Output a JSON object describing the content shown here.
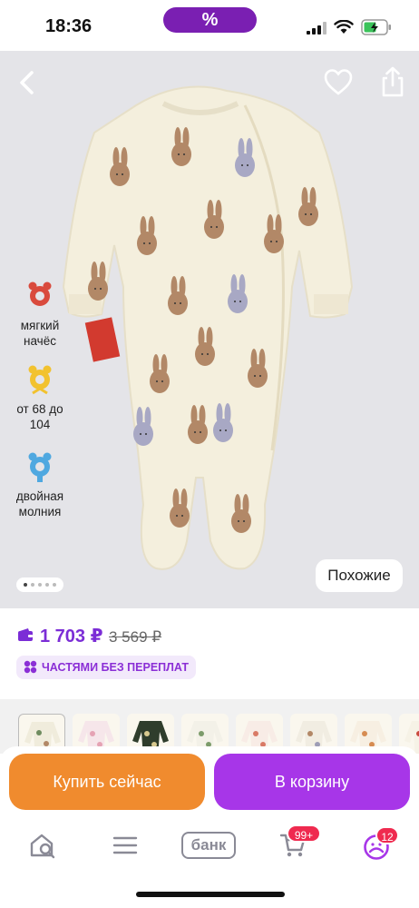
{
  "status_bar": {
    "time": "18:36",
    "promo_label": "%",
    "icons": [
      "signal-icon",
      "wifi-icon",
      "battery-icon"
    ]
  },
  "product": {
    "image": "baby-sleepsuit-bunny-print",
    "features": [
      {
        "icon": "fleece-icon",
        "label": "мягкий начёс",
        "color": "#d94a3d"
      },
      {
        "icon": "size-icon",
        "label": "от 68 до 104",
        "color": "#f2c22f"
      },
      {
        "icon": "zipper-icon",
        "label": "двойная молния",
        "color": "#4fa8e0"
      }
    ],
    "gallery": {
      "total": 5,
      "active": 0
    },
    "similar_label": "Похожие"
  },
  "price": {
    "current": "1 703 ₽",
    "old": "3 569 ₽",
    "installment_label": "ЧАСТЯМИ БЕЗ ПЕРЕПЛАТ",
    "accent_color": "#7b2dd6"
  },
  "variants": [
    {
      "name": "variant-1",
      "selected": true
    },
    {
      "name": "variant-2",
      "selected": false
    },
    {
      "name": "variant-3",
      "selected": false
    },
    {
      "name": "variant-4",
      "selected": false
    },
    {
      "name": "variant-5",
      "selected": false
    },
    {
      "name": "variant-6",
      "selected": false
    },
    {
      "name": "variant-7",
      "selected": false
    },
    {
      "name": "variant-8",
      "selected": false
    }
  ],
  "actions": {
    "buy_now": "Купить сейчас",
    "add_to_cart": "В корзину",
    "buy_color": "#f08b2e",
    "cart_color": "#a736e8"
  },
  "tabbar": {
    "bank_label": "банк",
    "cart_badge": "99+",
    "profile_badge": "12",
    "icons": [
      "home-search-icon",
      "catalog-icon",
      "bank-icon",
      "cart-icon",
      "profile-icon"
    ]
  }
}
